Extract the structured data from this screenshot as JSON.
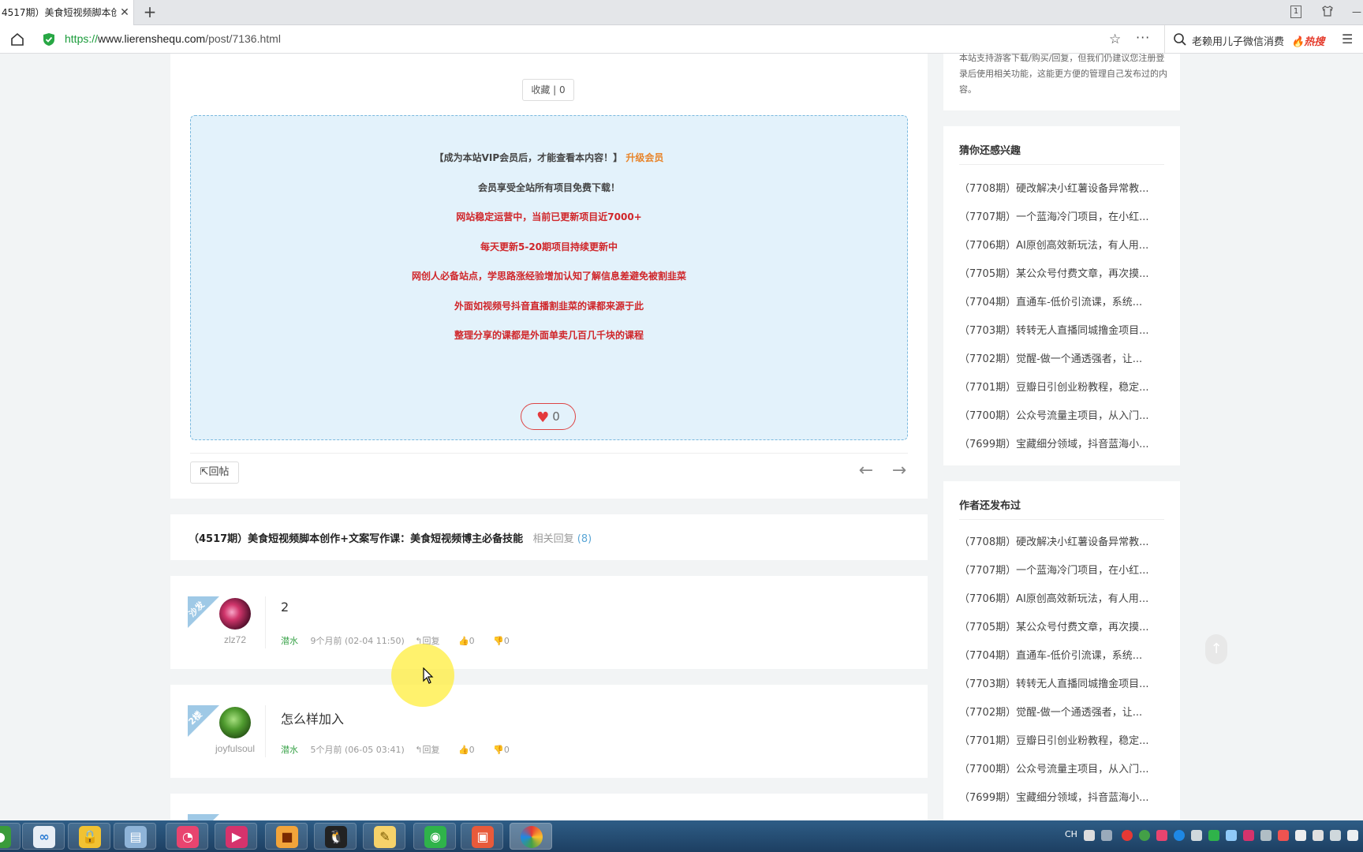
{
  "browser": {
    "tab_title": "4517期）美食短视频脚本创",
    "tab_close": "✕",
    "new_tab": "+",
    "url_proto": "https://",
    "url_domain": "www.lierenshequ.com",
    "url_path": "/post/7136.html",
    "search_text": "老赖用儿子微信消费",
    "search_hot": "热搜",
    "win_badge": "1"
  },
  "post": {
    "fav_label": "收藏 | 0",
    "vip": {
      "line1_prefix": "【成为本站VIP会员后，才能查看本内容！】",
      "upgrade_link": "升级会员",
      "line2": "会员享受全站所有项目免费下载！",
      "line3": "网站稳定运营中，当前已更新项目近7000+",
      "line4": "每天更新5-20期项目持续更新中",
      "line5": "网创人必备站点，学思路涨经验增加认知了解信息差避免被割韭菜",
      "line6": "外面如视频号抖音直播割韭菜的课都来源于此",
      "line7": "整理分享的课都是外面单卖几百几千块的课程"
    },
    "like_count": "0",
    "reply_label": "回帖",
    "title": "（4517期）美食短视频脚本创作+文案写作课：美食短视频博主必备技能",
    "related_label": "相关回复",
    "related_count": "(8)"
  },
  "comments": [
    {
      "floor": "沙发",
      "username": "zlz72",
      "content": "2",
      "level": "潜水",
      "time": "9个月前 (02-04 11:50)",
      "reply": "回复",
      "up": "0",
      "down": "0"
    },
    {
      "floor": "2楼",
      "username": "joyfulsoul",
      "content": "怎么样加入",
      "level": "潜水",
      "time": "5个月前 (06-05 03:41)",
      "reply": "回复",
      "up": "0",
      "down": "0"
    }
  ],
  "sidebar": {
    "notice": "本站支持游客下载/购买/回复，但我们仍建议您注册登录后使用相关功能，这能更方便的管理自己发布过的内容。",
    "interest_title": "猜你还感兴趣",
    "author_title": "作者还发布过",
    "items": [
      "（7708期）硬改解决小红薯设备异常教...",
      "（7707期）一个蓝海冷门项目，在小红...",
      "（7706期）AI原创高效新玩法，有人用...",
      "（7705期）某公众号付费文章，再次摸...",
      "（7704期）直通车-低价引流课，系统...",
      "（7703期）转转无人直播同城撸金项目...",
      "（7702期）觉醒-做一个通透强者，让...",
      "（7701期）豆瓣日引创业粉教程，稳定...",
      "（7700期）公众号流量主项目，从入门...",
      "（7699期）宝藏细分领域，抖音蓝海小..."
    ]
  },
  "taskbar": {
    "tray_lang": "CH"
  }
}
